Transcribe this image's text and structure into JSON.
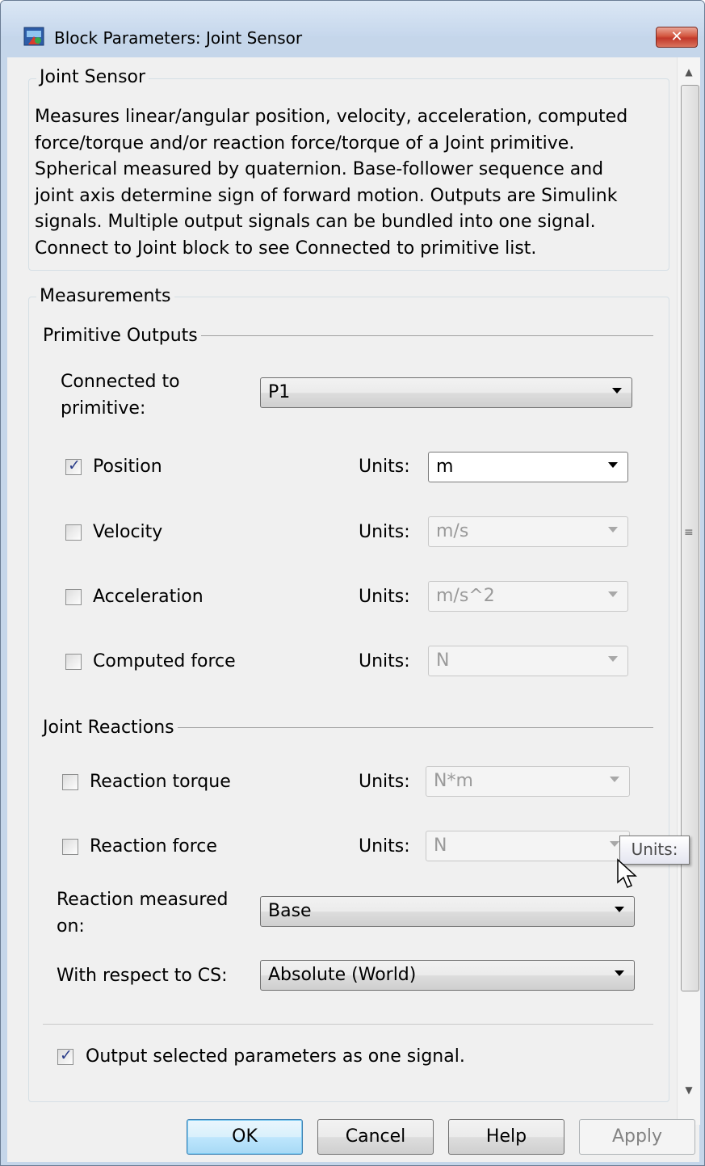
{
  "window": {
    "title": "Block Parameters: Joint Sensor",
    "close_glyph": "✕"
  },
  "block": {
    "legend": "Joint Sensor",
    "description_lines": [
      "Measures linear/angular position, velocity, acceleration, computed",
      "force/torque and/or reaction force/torque of a Joint primitive.",
      "Spherical measured by quaternion. Base-follower sequence and",
      "joint axis determine sign of forward motion. Outputs are Simulink",
      "signals. Multiple output signals can be bundled into one signal.",
      "Connect to Joint block to see Connected to primitive list."
    ]
  },
  "measurements": {
    "legend": "Measurements",
    "primitive_outputs": {
      "label": "Primitive Outputs",
      "connected_label_1": "Connected to",
      "connected_label_2": "primitive:",
      "connected_value": "P1",
      "rows": [
        {
          "label": "Position",
          "checked": true,
          "units_label": "Units:",
          "units_value": "m",
          "enabled": true
        },
        {
          "label": "Velocity",
          "checked": false,
          "units_label": "Units:",
          "units_value": "m/s",
          "enabled": false
        },
        {
          "label": "Acceleration",
          "checked": false,
          "units_label": "Units:",
          "units_value": "m/s^2",
          "enabled": false
        },
        {
          "label": "Computed force",
          "checked": false,
          "units_label": "Units:",
          "units_value": "N",
          "enabled": false
        }
      ]
    },
    "joint_reactions": {
      "label": "Joint Reactions",
      "rows": [
        {
          "label": "Reaction torque",
          "checked": false,
          "units_label": "Units:",
          "units_value": "N*m",
          "enabled": false
        },
        {
          "label": "Reaction force",
          "checked": false,
          "units_label": "Units:",
          "units_value": "N",
          "enabled": false
        }
      ],
      "measured_on_label_1": "Reaction measured",
      "measured_on_label_2": "on:",
      "measured_on_value": "Base",
      "wrt_label": "With respect to CS:",
      "wrt_value": "Absolute (World)"
    },
    "output_one_signal": {
      "label": "Output selected parameters as one signal.",
      "checked": true
    }
  },
  "tooltip": {
    "text": "Units:"
  },
  "buttons": {
    "ok": "OK",
    "cancel": "Cancel",
    "help": "Help",
    "apply": "Apply"
  },
  "icons": {
    "checkmark": "✓",
    "grip": "≡",
    "up_arrow": "▲",
    "down_arrow": "▼"
  }
}
